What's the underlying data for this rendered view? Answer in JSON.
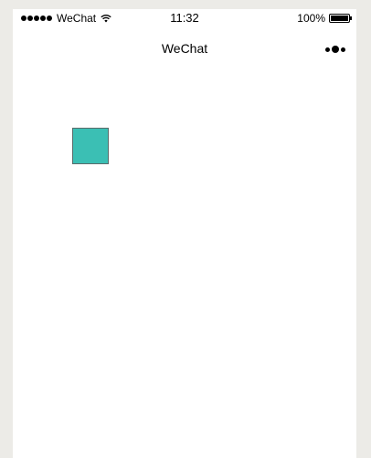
{
  "status_bar": {
    "carrier": "WeChat",
    "time": "11:32",
    "battery": "100%",
    "signal_icon": "signal-dots-icon",
    "wifi_icon": "wifi-icon",
    "battery_icon": "battery-icon"
  },
  "nav": {
    "title": "WeChat",
    "more_icon": "more-dots-icon"
  },
  "content": {
    "box_color": "#3bbfb4"
  },
  "colors": {
    "page_background": "#ecebe7",
    "screen_background": "#ffffff"
  }
}
